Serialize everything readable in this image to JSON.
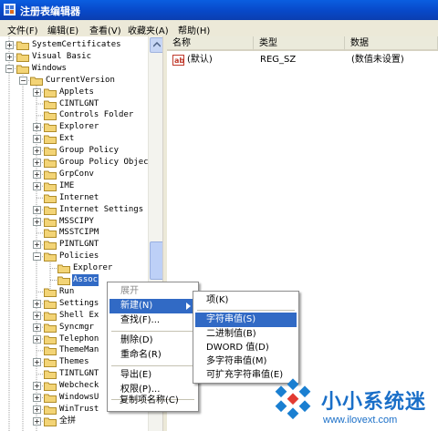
{
  "window": {
    "title": "注册表编辑器"
  },
  "menubar": [
    "文件(F)",
    "编辑(E)",
    "查看(V)",
    "收藏夹(A)",
    "帮助(H)"
  ],
  "tree": {
    "items": [
      {
        "label": "SystemCertificates",
        "expander": "+"
      },
      {
        "label": "Visual Basic",
        "expander": "+"
      },
      {
        "label": "Windows",
        "expander": "-"
      },
      {
        "label": "CurrentVersion",
        "expander": "-"
      },
      {
        "label": "Applets",
        "expander": "+"
      },
      {
        "label": "CINTLGNT",
        "expander": ""
      },
      {
        "label": "Controls Folder",
        "expander": ""
      },
      {
        "label": "Explorer",
        "expander": "+"
      },
      {
        "label": "Ext",
        "expander": "+"
      },
      {
        "label": "Group Policy",
        "expander": "+"
      },
      {
        "label": "Group Policy Objec",
        "expander": "+"
      },
      {
        "label": "GrpConv",
        "expander": "+"
      },
      {
        "label": "IME",
        "expander": "+"
      },
      {
        "label": "Internet",
        "expander": ""
      },
      {
        "label": "Internet Settings",
        "expander": "+"
      },
      {
        "label": "MSSCIPY",
        "expander": "+"
      },
      {
        "label": "MSSTCIPM",
        "expander": ""
      },
      {
        "label": "PINTLGNT",
        "expander": "+"
      },
      {
        "label": "Policies",
        "expander": "-"
      },
      {
        "label": "Explorer",
        "expander": ""
      },
      {
        "label": "Assoc",
        "expander": "",
        "selected": true
      },
      {
        "label": "Run",
        "expander": ""
      },
      {
        "label": "Settings",
        "expander": "+"
      },
      {
        "label": "Shell Ex",
        "expander": "+"
      },
      {
        "label": "Syncmgr",
        "expander": "+"
      },
      {
        "label": "Telephon",
        "expander": "+"
      },
      {
        "label": "ThemeMan",
        "expander": ""
      },
      {
        "label": "Themes",
        "expander": "+"
      },
      {
        "label": "TINTLGNT",
        "expander": ""
      },
      {
        "label": "Webcheck",
        "expander": "+"
      },
      {
        "label": "WindowsU",
        "expander": "+"
      },
      {
        "label": "WinTrust",
        "expander": "+"
      },
      {
        "label": "全拼",
        "expander": "+"
      }
    ]
  },
  "list": {
    "columns": [
      "名称",
      "类型",
      "数据"
    ],
    "rows": [
      {
        "name": "(默认)",
        "type": "REG_SZ",
        "data": "(数值未设置)"
      }
    ]
  },
  "context_menu": {
    "items": [
      "展开",
      "新建(N)",
      "查找(F)...",
      "删除(D)",
      "重命名(R)",
      "导出(E)",
      "权限(P)...",
      "复制项名称(C)"
    ]
  },
  "submenu": {
    "items": [
      "项(K)",
      "字符串值(S)",
      "二进制值(B)",
      "DWORD 值(D)",
      "多字符串值(M)",
      "可扩充字符串值(E)"
    ],
    "highlighted": "字符串值(S)"
  },
  "watermark": {
    "text": "小小系统迷",
    "url": "www.ilovext.com"
  },
  "colors": {
    "selection": "#316ac5",
    "folder": "#f3d476",
    "titlebar": "#0a5ee0"
  }
}
